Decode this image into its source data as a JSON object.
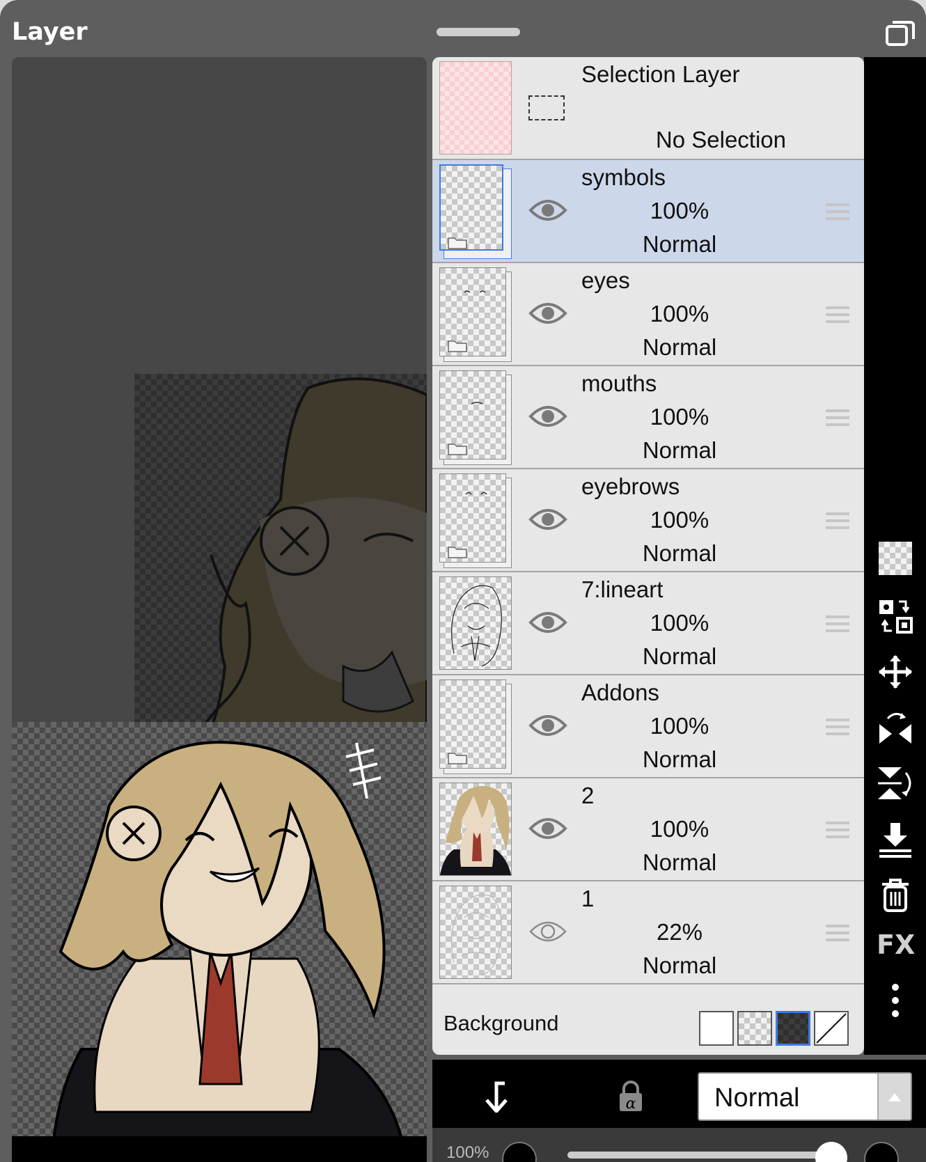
{
  "header": {
    "title": "Layer"
  },
  "selection_layer": {
    "name": "Selection Layer",
    "status": "No Selection"
  },
  "layers": [
    {
      "name": "symbols",
      "opacity": "100%",
      "blend": "Normal",
      "folder": true,
      "selected": true,
      "visible": true
    },
    {
      "name": "eyes",
      "opacity": "100%",
      "blend": "Normal",
      "folder": true,
      "selected": false,
      "visible": true
    },
    {
      "name": "mouths",
      "opacity": "100%",
      "blend": "Normal",
      "folder": true,
      "selected": false,
      "visible": true
    },
    {
      "name": "eyebrows",
      "opacity": "100%",
      "blend": "Normal",
      "folder": true,
      "selected": false,
      "visible": true
    },
    {
      "name": "7:lineart",
      "opacity": "100%",
      "blend": "Normal",
      "folder": false,
      "selected": false,
      "visible": true
    },
    {
      "name": "Addons",
      "opacity": "100%",
      "blend": "Normal",
      "folder": true,
      "selected": false,
      "visible": true
    },
    {
      "name": "2",
      "opacity": "100%",
      "blend": "Normal",
      "folder": false,
      "selected": false,
      "visible": true
    },
    {
      "name": "1",
      "opacity": "22%",
      "blend": "Normal",
      "folder": false,
      "selected": false,
      "visible": true
    }
  ],
  "background": {
    "label": "Background",
    "options": [
      "white",
      "transparent",
      "dark-checker",
      "none"
    ],
    "selected": "dark-checker"
  },
  "tools": [
    "transparency-checker-icon",
    "swap-layers-icon",
    "move-icon",
    "flip-horizontal-icon",
    "flip-vertical-icon",
    "merge-down-icon",
    "trash-icon",
    "fx-icon",
    "more-icon"
  ],
  "tool_labels": {
    "fx": "FX"
  },
  "bottom_bar": {
    "blend_mode": "Normal",
    "opacity_label": "100%"
  },
  "colors": {
    "selected_row": "#ccd7ea",
    "selected_border": "#3f7ae3",
    "panel": "#e7e7e7",
    "app_bg": "#5e5e5e"
  }
}
